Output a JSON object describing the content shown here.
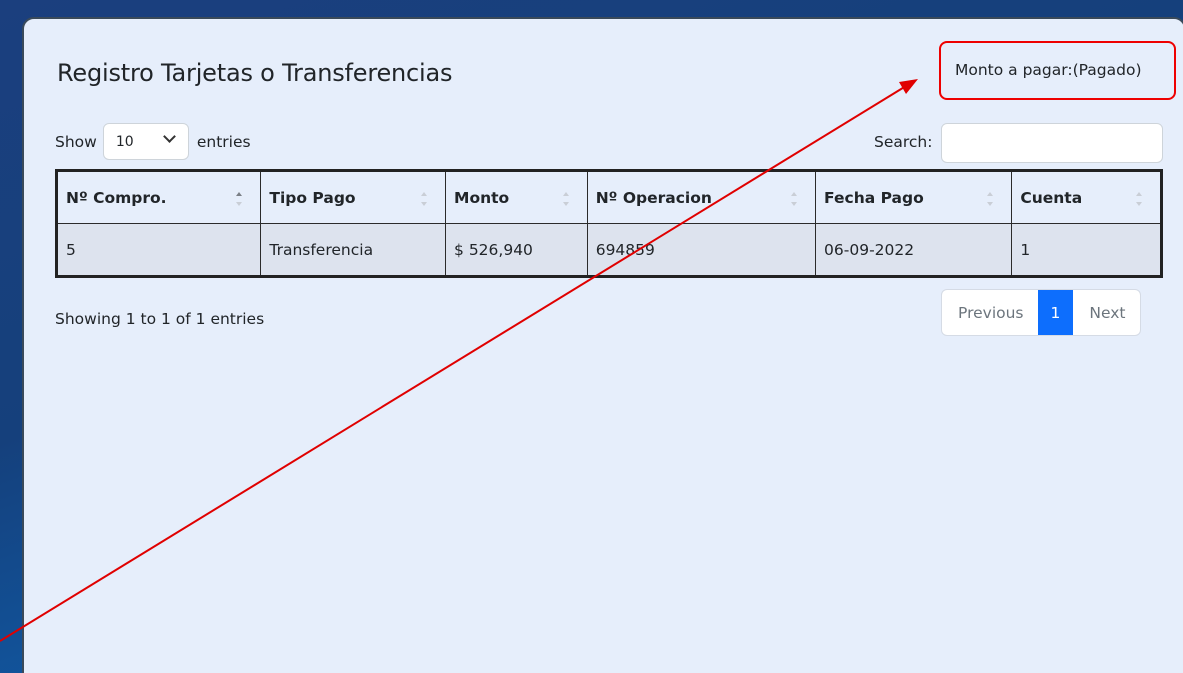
{
  "panel": {
    "title": "Registro Tarjetas o Transferencias",
    "monto_label": "Monto a pagar:(Pagado)"
  },
  "controls": {
    "show_label": "Show",
    "page_size": "10",
    "entries_label": "entries",
    "search_label": "Search:"
  },
  "table": {
    "headers": [
      "Nº Compro.",
      "Tipo Pago",
      "Monto",
      "Nº Operacion",
      "Fecha Pago",
      "Cuenta"
    ],
    "rows": [
      [
        "5",
        "Transferencia",
        "$ 526,940",
        "694859",
        "06-09-2022",
        "1"
      ]
    ]
  },
  "footer": {
    "info": "Showing 1 to 1 of 1 entries",
    "prev_label": "Previous",
    "page_label": "1",
    "next_label": "Next"
  },
  "annotation": {
    "color": "#e00000"
  }
}
